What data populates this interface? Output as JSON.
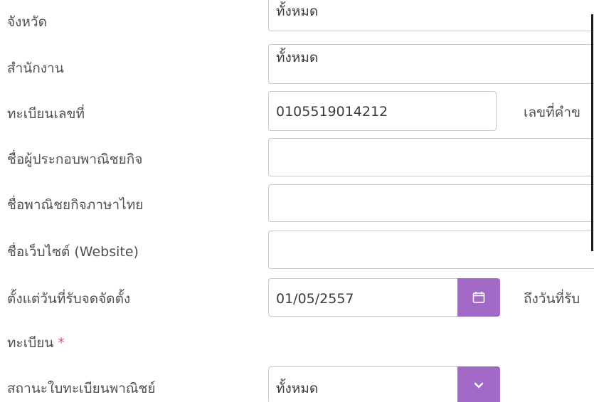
{
  "form": {
    "province": {
      "label": "จังหวัด",
      "value": "ทั้งหมด"
    },
    "office": {
      "label": "สำนักงาน",
      "value": "ทั้งหมด"
    },
    "registration_number": {
      "label": "ทะเบียนเลขที่",
      "value": "0105519014212",
      "side_label": "เลขที่คำข"
    },
    "operator_name": {
      "label": "ชื่อผู้ประกอบพาณิชยกิจ",
      "value": ""
    },
    "business_name_th": {
      "label": "ชื่อพาณิชยกิจภาษาไทย",
      "value": ""
    },
    "website_name": {
      "label": "ชื่อเว็บไซต์ (Website)",
      "value": ""
    },
    "registration_date_from": {
      "label_line1": "ตั้งแต่วันที่รับจดจัดตั้ง",
      "label_line2": "ทะเบียน",
      "required_mark": "*",
      "value": "01/05/2557",
      "side_label": "ถึงวันที่รับ",
      "icon": "calendar-icon"
    },
    "registration_status": {
      "label": "สถานะใบทะเบียนพาณิชย์",
      "value": "ทั้งหมด",
      "icon": "chevron-down-icon"
    }
  },
  "colors": {
    "accent": "#a26ac6",
    "border": "#c9c9c9",
    "required": "#e05a6a",
    "label_text": "#505050"
  }
}
